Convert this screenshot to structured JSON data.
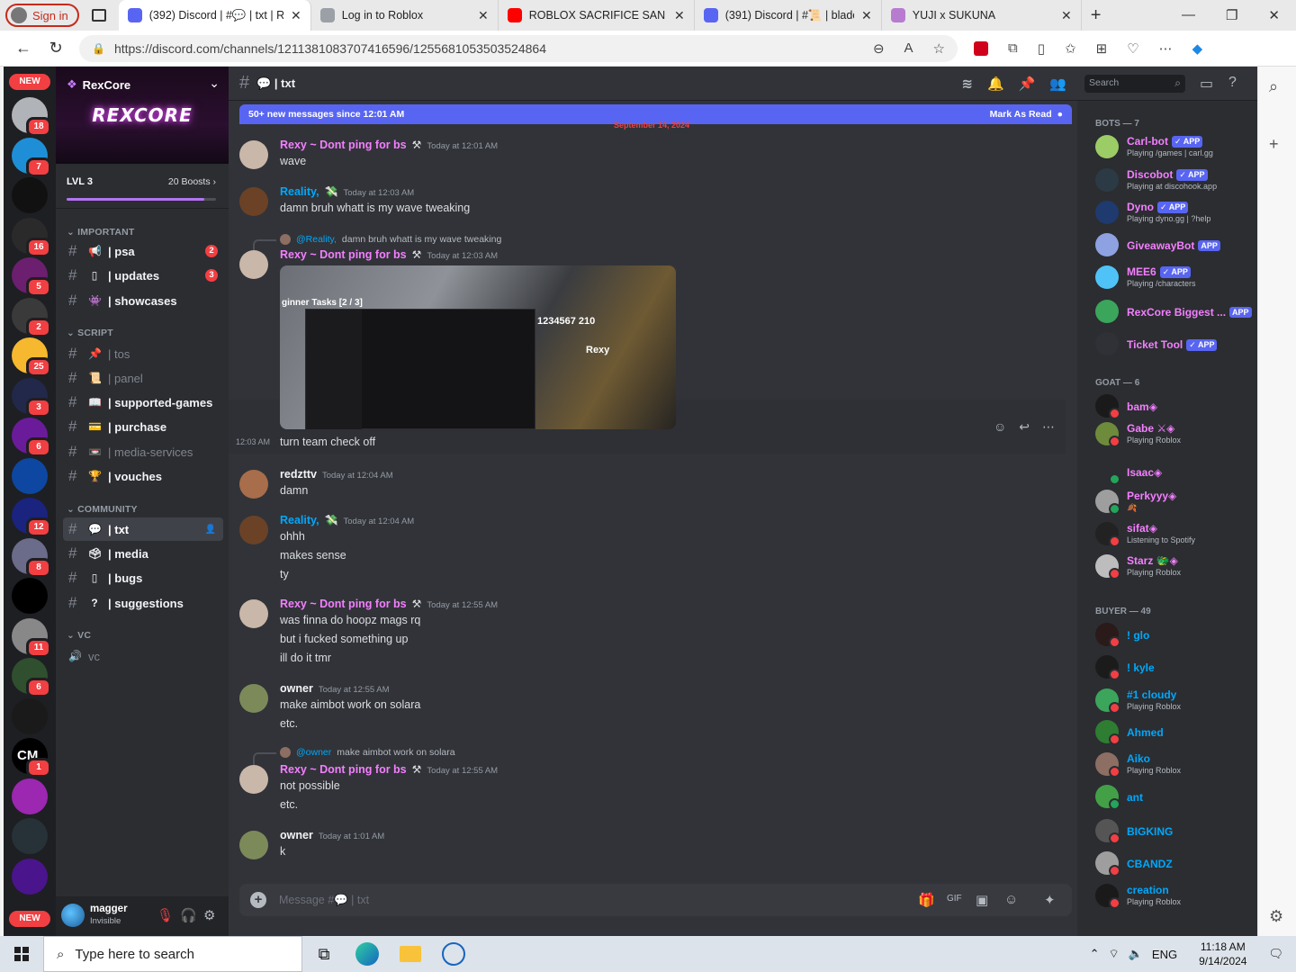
{
  "browser": {
    "signin_label": "Sign in",
    "tabs": [
      {
        "title": "(392) Discord | #💬 | txt | RexC",
        "color": "#5865f2",
        "active": true
      },
      {
        "title": "Log in to Roblox",
        "color": "#9aa0a6"
      },
      {
        "title": "ROBLOX SACRIFICE SAN",
        "color": "#ff0000"
      },
      {
        "title": "(391) Discord | #📜 | blade-b",
        "color": "#5865f2"
      },
      {
        "title": "YUJI x SUKUNA",
        "color": "#b77ccf"
      }
    ],
    "url": "https://discord.com/channels/1211381083707416596/1255681053503524864"
  },
  "guild_bar": {
    "new_top": "NEW",
    "new_bottom": "NEW",
    "guilds": [
      {
        "badge": "18",
        "color": "#b0b3b8"
      },
      {
        "badge": "7",
        "color": "#1e8fd6"
      },
      {
        "badge": "",
        "color": "#111"
      },
      {
        "badge": "16",
        "color": "#2a2a2a"
      },
      {
        "badge": "5",
        "color": "#6b1f6e"
      },
      {
        "badge": "2",
        "color": "#3a3a3a"
      },
      {
        "badge": "25",
        "color": "#f5b82e"
      },
      {
        "badge": "3",
        "color": "#22284a"
      },
      {
        "badge": "6",
        "color": "#6a1b9a"
      },
      {
        "badge": "",
        "color": "#0d47a1"
      },
      {
        "badge": "12",
        "color": "#1a237e"
      },
      {
        "badge": "8",
        "color": "#6b6b8a"
      },
      {
        "badge": "",
        "color": "#000"
      },
      {
        "badge": "11",
        "color": "#888"
      },
      {
        "badge": "6",
        "color": "#2f4f2f"
      },
      {
        "badge": "",
        "color": "#1a1a1a"
      },
      {
        "badge": "1",
        "color": "#b71c1c"
      },
      {
        "badge": "",
        "color": "#9c27b0"
      },
      {
        "badge": "",
        "color": "#263238"
      },
      {
        "badge": "",
        "color": "#4a148c"
      }
    ],
    "cm_label": "CM"
  },
  "server": {
    "name": "RexCore",
    "logo_text": "REXCORE",
    "level": "LVL 3",
    "boosts": "20 Boosts",
    "boost_progress": 0.92,
    "categories": [
      {
        "name": "IMPORTANT",
        "channels": [
          {
            "emoji": "📢",
            "name": "| psa",
            "badge": "2"
          },
          {
            "emoji": "▯",
            "name": "| updates",
            "badge": "3"
          },
          {
            "emoji": "👾",
            "name": "| showcases",
            "badge": ""
          }
        ]
      },
      {
        "name": "SCRIPT",
        "channels": [
          {
            "emoji": "📌",
            "name": "| tos",
            "muted": true
          },
          {
            "emoji": "📜",
            "name": "| panel",
            "muted": true
          },
          {
            "emoji": "📖",
            "name": "| supported-games"
          },
          {
            "emoji": "💳",
            "name": "| purchase"
          },
          {
            "emoji": "📼",
            "name": "| media-services",
            "muted": true
          },
          {
            "emoji": "🏆",
            "name": "| vouches"
          }
        ]
      },
      {
        "name": "COMMUNITY",
        "channels": [
          {
            "emoji": "💬",
            "name": "| txt",
            "selected": true
          },
          {
            "emoji": "🗳",
            "name": "| media"
          },
          {
            "emoji": "▯",
            "name": "| bugs"
          },
          {
            "emoji": "?",
            "name": "| suggestions"
          }
        ]
      },
      {
        "name": "VC",
        "channels": [
          {
            "emoji": "🔊",
            "name": "vc",
            "voice": true
          }
        ]
      }
    ]
  },
  "user": {
    "name": "magger",
    "status": "Invisible"
  },
  "channel": {
    "name": "💬 | txt",
    "new_banner": "50+ new messages since 12:01 AM",
    "mark_read": "Mark As Read",
    "date_divider": "September 14, 2024",
    "placeholder": "Message #💬 | txt"
  },
  "messages": [
    {
      "author": "Rexy ~ Dont ping for bs",
      "tag": "⚒",
      "color": "pink",
      "time": "Today at 12:01 AM",
      "lines": [
        "wave"
      ],
      "avatar": "#c9b7a9"
    },
    {
      "author": "Reality,",
      "tag": "💸",
      "color": "blue",
      "time": "Today at 12:03 AM",
      "lines": [
        "damn bruh whatt is my wave tweaking"
      ],
      "avatar": "#6b4226"
    },
    {
      "reply_author": "@Reality,",
      "reply_text": "damn bruh whatt is my wave tweaking",
      "author": "Rexy ~ Dont ping for bs",
      "tag": "⚒",
      "color": "pink",
      "time": "Today at 12:03 AM",
      "avatar": "#c9b7a9"
    },
    {
      "stamp": "12:03 AM",
      "lines": [
        "turn team check off"
      ]
    },
    {
      "author": "redzttv",
      "color": "white",
      "time": "Today at 12:04 AM",
      "lines": [
        "damn"
      ],
      "avatar": "#a86d4a"
    },
    {
      "author": "Reality,",
      "tag": "💸",
      "color": "blue",
      "time": "Today at 12:04 AM",
      "lines": [
        "ohhh",
        "makes sense",
        "ty"
      ],
      "avatar": "#6b4226"
    },
    {
      "author": "Rexy ~ Dont ping for bs",
      "tag": "⚒",
      "color": "pink",
      "time": "Today at 12:55 AM",
      "lines": [
        "was finna do hoopz mags rq",
        "but i fucked something up",
        "ill do it tmr"
      ],
      "avatar": "#c9b7a9"
    },
    {
      "author": "owner",
      "color": "white",
      "time": "Today at 12:55 AM",
      "lines": [
        "make aimbot work on solara",
        "etc."
      ],
      "avatar": "#7c8a5a"
    },
    {
      "reply_author": "@owner",
      "reply_text": "make aimbot work on solara",
      "author": "Rexy ~ Dont ping for bs",
      "tag": "⚒",
      "color": "pink",
      "time": "Today at 12:55 AM",
      "lines": [
        "not possible",
        "etc."
      ],
      "avatar": "#c9b7a9"
    },
    {
      "author": "owner",
      "color": "white",
      "time": "Today at 1:01 AM",
      "lines": [
        "k"
      ],
      "avatar": "#7c8a5a"
    }
  ],
  "attachment": {
    "tasks": "ginner Tasks  [2 / 3]",
    "counter": "1234567 210",
    "player": "Rexy"
  },
  "members": {
    "search_placeholder": "Search",
    "groups": [
      {
        "title": "BOTS — 7",
        "members": [
          {
            "name": "Carl-bot",
            "app": "✓ APP",
            "activity": "Playing /games | carl.gg",
            "color": "#f47fff",
            "avatar": "#9ccc65"
          },
          {
            "name": "Discobot",
            "app": "✓ APP",
            "activity": "Playing at discohook.app",
            "color": "#f47fff",
            "avatar": "#2b3a44"
          },
          {
            "name": "Dyno",
            "app": "✓ APP",
            "activity": "Playing dyno.gg | ?help",
            "color": "#f47fff",
            "avatar": "#1e3a6e"
          },
          {
            "name": "GiveawayBot",
            "app": "APP",
            "activity": "",
            "color": "#f47fff",
            "avatar": "#8ea1e1"
          },
          {
            "name": "MEE6",
            "app": "✓ APP",
            "activity": "Playing /characters",
            "color": "#f47fff",
            "avatar": "#4fc3f7"
          },
          {
            "name": "RexCore Biggest ...",
            "app": "APP",
            "activity": "",
            "color": "#f47fff",
            "avatar": "#3ba55c"
          },
          {
            "name": "Ticket Tool",
            "app": "✓ APP",
            "activity": "",
            "color": "#f47fff",
            "avatar": "#2f3136"
          }
        ]
      },
      {
        "title": "GOAT — 6",
        "members": [
          {
            "name": "bam",
            "suffix": "◈",
            "activity": "",
            "color": "#f47fff",
            "avatar": "#1a1a1a",
            "status": "#f23f43"
          },
          {
            "name": "Gabe ⚔",
            "suffix": "◈",
            "activity": "Playing Roblox",
            "color": "#f47fff",
            "avatar": "#6d8b3a",
            "status": "#f23f43"
          },
          {
            "name": "Isaac",
            "suffix": "◈",
            "activity": "",
            "color": "#f47fff",
            "avatar": "#2b2d31",
            "status": "#23a55a"
          },
          {
            "name": "Perkyyy",
            "suffix": "◈",
            "activity": "🍂",
            "color": "#f47fff",
            "avatar": "#9e9e9e",
            "status": "#23a55a"
          },
          {
            "name": "sifat",
            "suffix": "◈",
            "activity": "Listening to Spotify",
            "color": "#f47fff",
            "avatar": "#222",
            "status": "#f23f43"
          },
          {
            "name": "Starz 🐲",
            "suffix": "◈",
            "activity": "Playing Roblox",
            "color": "#f47fff",
            "avatar": "#bdbdbd",
            "status": "#f23f43"
          }
        ]
      },
      {
        "title": "BUYER — 49",
        "members": [
          {
            "name": "! glo",
            "activity": "",
            "color": "#00a8fc",
            "avatar": "#2a1a1a",
            "status": "#f23f43"
          },
          {
            "name": "! kyle",
            "activity": "",
            "color": "#00a8fc",
            "avatar": "#1b1b1b",
            "status": "#f23f43"
          },
          {
            "name": "#1 cloudy",
            "activity": "Playing Roblox",
            "color": "#00a8fc",
            "avatar": "#3ba55c",
            "status": "#f23f43"
          },
          {
            "name": "Ahmed",
            "activity": "",
            "color": "#00a8fc",
            "avatar": "#2e7d32",
            "status": "#f23f43"
          },
          {
            "name": "Aiko",
            "activity": "Playing Roblox",
            "color": "#00a8fc",
            "avatar": "#8d6e63",
            "status": "#f23f43"
          },
          {
            "name": "ant",
            "activity": "",
            "color": "#00a8fc",
            "avatar": "#43a047",
            "status": "#23a55a"
          },
          {
            "name": "BIGKING",
            "activity": "",
            "color": "#00a8fc",
            "avatar": "#555",
            "status": "#f23f43"
          },
          {
            "name": "CBANDZ",
            "activity": "",
            "color": "#00a8fc",
            "avatar": "#9e9e9e",
            "status": "#f23f43"
          },
          {
            "name": "creation",
            "activity": "Playing Roblox",
            "color": "#00a8fc",
            "avatar": "#1a1a1a",
            "status": "#f23f43"
          }
        ]
      }
    ]
  },
  "taskbar": {
    "search_placeholder": "Type here to search",
    "time": "11:18 AM",
    "date": "9/14/2024"
  }
}
